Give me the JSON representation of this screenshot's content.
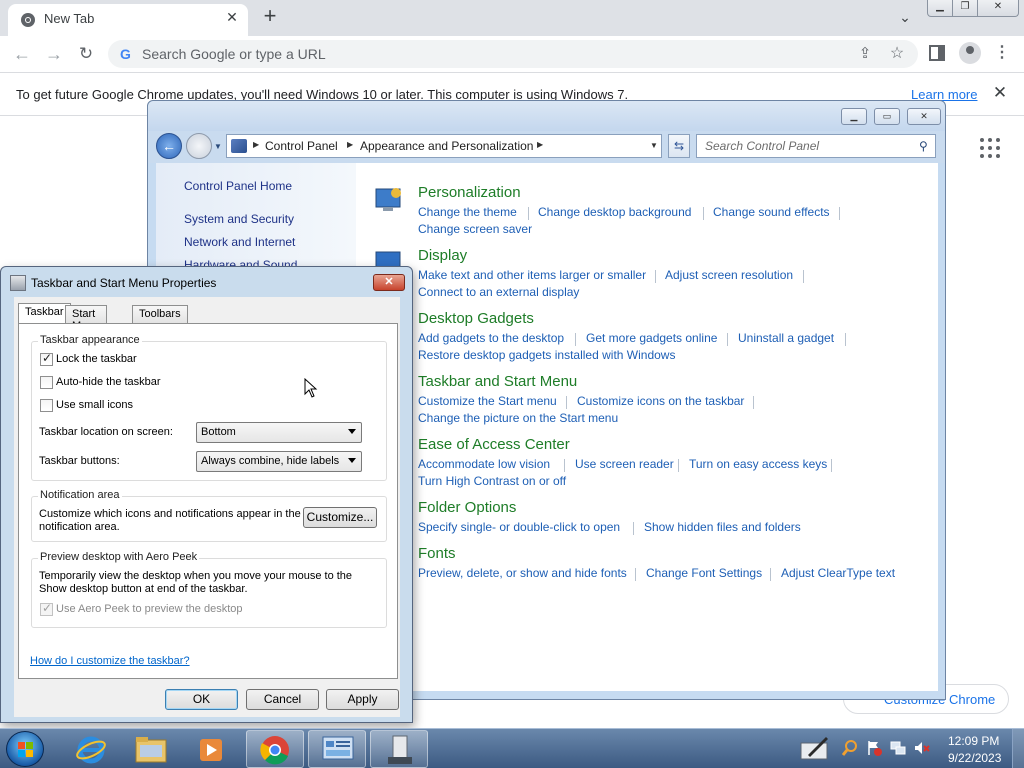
{
  "browser": {
    "tab_title": "New Tab",
    "omnibox_placeholder": "Search Google or type a URL",
    "infobar_text": "To get future Google Chrome updates, you'll need Windows 10 or later. This computer is using Windows 7.",
    "infobar_link": "Learn more",
    "customize_label": "Customize Chrome"
  },
  "control_panel": {
    "breadcrumb": [
      "Control Panel",
      "Appearance and Personalization"
    ],
    "search_placeholder": "Search Control Panel",
    "sidebar": [
      "Control Panel Home",
      "System and Security",
      "Network and Internet",
      "Hardware and Sound"
    ],
    "categories": [
      {
        "title": "Personalization",
        "links": [
          "Change the theme",
          "Change desktop background",
          "Change sound effects",
          "Change screen saver"
        ]
      },
      {
        "title": "Display",
        "links": [
          "Make text and other items larger or smaller",
          "Adjust screen resolution",
          "Connect to an external display"
        ]
      },
      {
        "title": "Desktop Gadgets",
        "links": [
          "Add gadgets to the desktop",
          "Get more gadgets online",
          "Uninstall a gadget",
          "Restore desktop gadgets installed with Windows"
        ]
      },
      {
        "title": "Taskbar and Start Menu",
        "links": [
          "Customize the Start menu",
          "Customize icons on the taskbar",
          "Change the picture on the Start menu"
        ]
      },
      {
        "title": "Ease of Access Center",
        "links": [
          "Accommodate low vision",
          "Use screen reader",
          "Turn on easy access keys",
          "Turn High Contrast on or off"
        ]
      },
      {
        "title": "Folder Options",
        "links": [
          "Specify single- or double-click to open",
          "Show hidden files and folders"
        ]
      },
      {
        "title": "Fonts",
        "links": [
          "Preview, delete, or show and hide fonts",
          "Change Font Settings",
          "Adjust ClearType text"
        ]
      }
    ]
  },
  "taskbar_dialog": {
    "title": "Taskbar and Start Menu Properties",
    "tabs": [
      "Taskbar",
      "Start Menu",
      "Toolbars"
    ],
    "appearance_group": "Taskbar appearance",
    "lock_label": "Lock the taskbar",
    "lock_checked": true,
    "autohide_label": "Auto-hide the taskbar",
    "autohide_checked": false,
    "small_icons_label": "Use small icons",
    "small_icons_checked": false,
    "location_label": "Taskbar location on screen:",
    "location_value": "Bottom",
    "buttons_label": "Taskbar buttons:",
    "buttons_value": "Always combine, hide labels",
    "notification_group": "Notification area",
    "notification_text": "Customize which icons and notifications appear in the notification area.",
    "customize_button": "Customize...",
    "aero_group": "Preview desktop with Aero Peek",
    "aero_text": "Temporarily view the desktop when you move your mouse to the Show desktop button at end of the taskbar.",
    "aero_checkbox": "Use Aero Peek to preview the desktop",
    "help_link": "How do I customize the taskbar?",
    "ok": "OK",
    "cancel": "Cancel",
    "apply": "Apply"
  },
  "system_tray": {
    "time": "12:09 PM",
    "date": "9/22/2023"
  },
  "colors": {
    "link_blue": "#1e5fb5",
    "category_green": "#1e7d28",
    "chrome_link": "#1a73e8",
    "taskbar_blue": "#3c5a82"
  }
}
